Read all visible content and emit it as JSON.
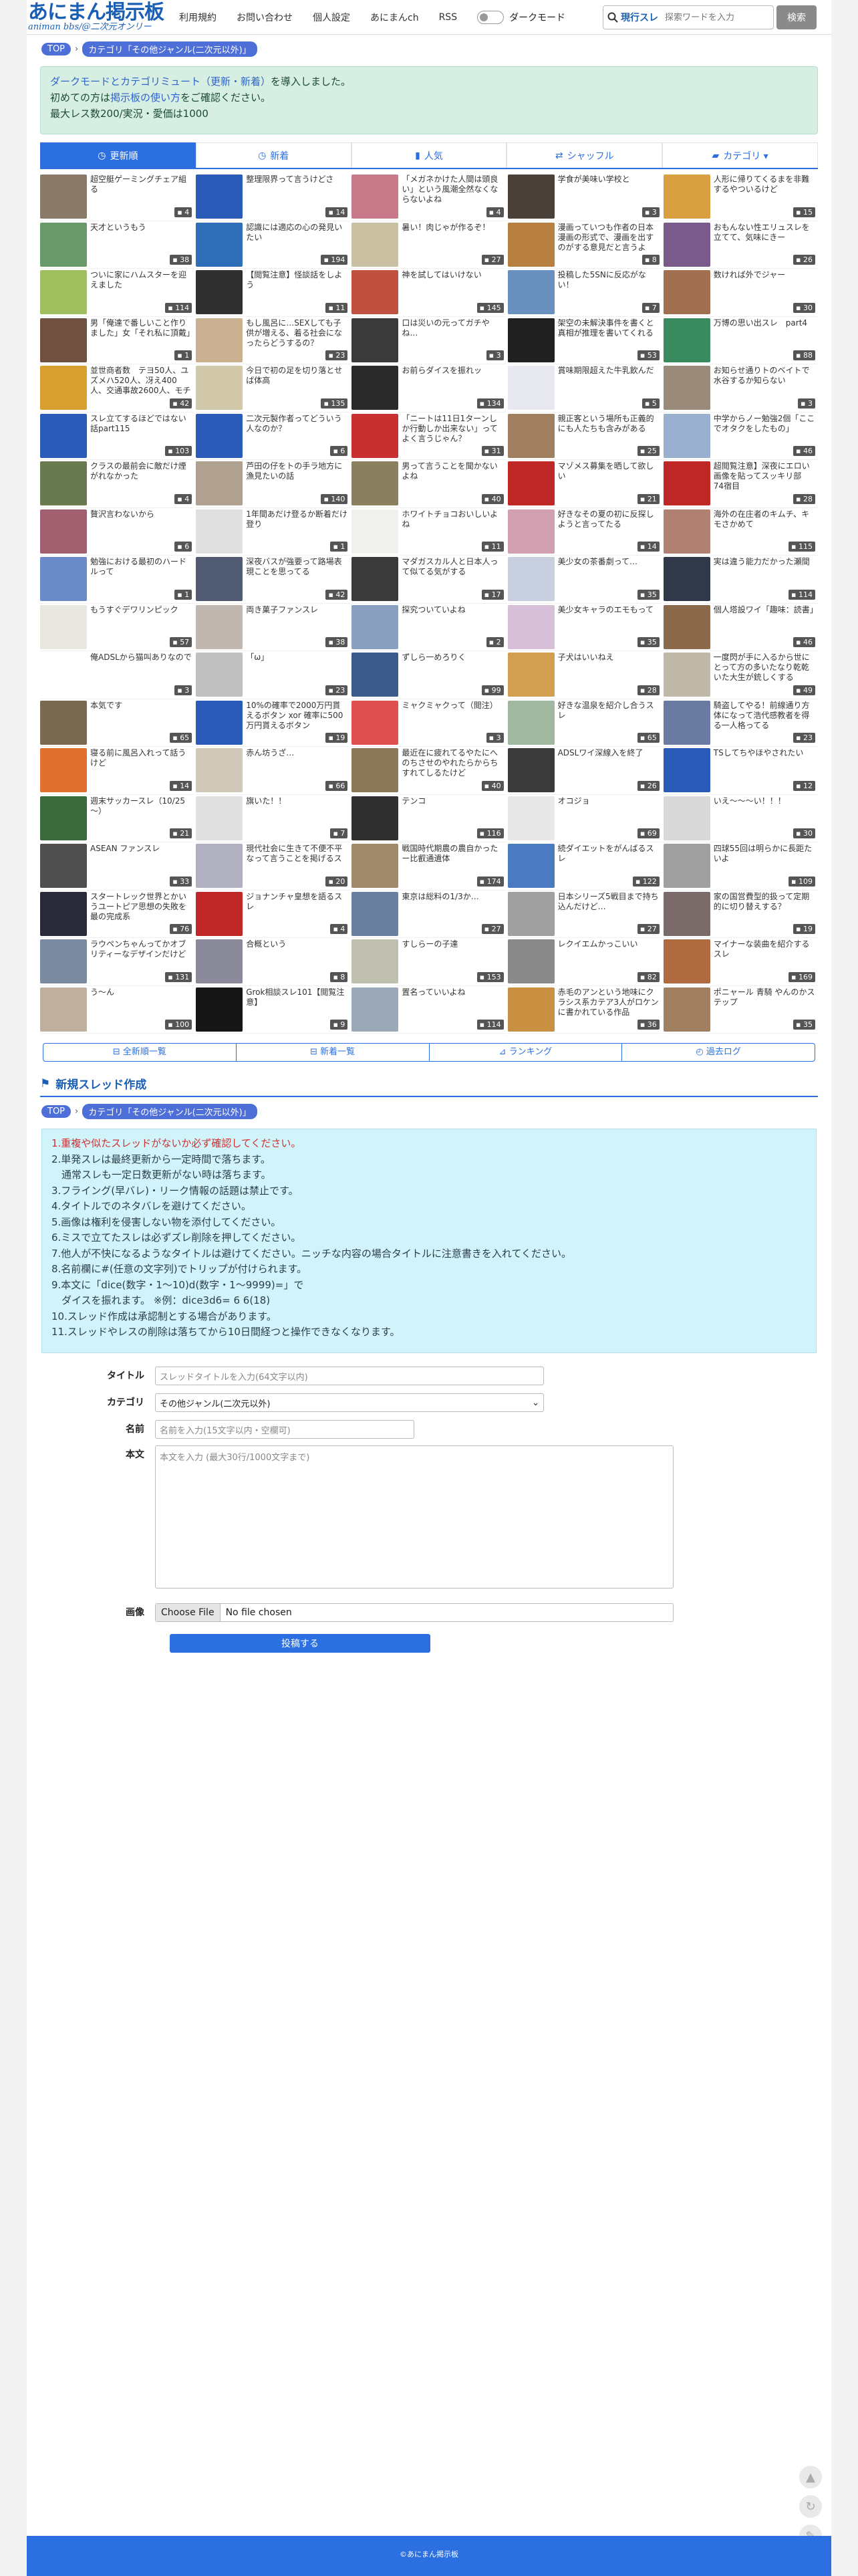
{
  "header": {
    "logo_title": "あにまん掲示板",
    "logo_sub": "animan bbs/@二次元オンリー",
    "nav": [
      "利用規約",
      "お問い合わせ",
      "個人設定",
      "あにまんch",
      "RSS"
    ],
    "dark_mode_label": "ダークモード",
    "search_scope": "現行スレ",
    "search_placeholder": "探索ワードを入力",
    "search_button": "検索"
  },
  "breadcrumb": {
    "top": "TOP",
    "category": "カテゴリ「その他ジャンル(二次元以外)」"
  },
  "notice": {
    "line1_link": "ダークモードとカテゴリミュート（更新・新着）",
    "line1_rest": "を導入しました。",
    "line2_pre": "初めての方は",
    "line2_link": "掲示板の使い方",
    "line2_rest": "をご確認ください。",
    "line3": "最大レス数200/実況・愛価は1000"
  },
  "tabs": [
    {
      "label": "更新順",
      "icon": "clock-icon"
    },
    {
      "label": "新着",
      "icon": "clock-icon"
    },
    {
      "label": "人気",
      "icon": "bar-chart-icon"
    },
    {
      "label": "シャッフル",
      "icon": "shuffle-icon"
    },
    {
      "label": "カテゴリ ▾",
      "icon": "folder-icon"
    }
  ],
  "threads": [
    {
      "title": "超空艇ゲーミングチェア組る",
      "count": "4",
      "color": "#8a7a6a"
    },
    {
      "title": "整理限界って言うけどさ",
      "count": "14",
      "color": "#2a5bb8"
    },
    {
      "title": "「メガネかけた人間は頭良い」という風潮全然なくならないよね",
      "count": "4",
      "color": "#c87a8a"
    },
    {
      "title": "学食が美味い学校と",
      "count": "3",
      "color": "#4a4038"
    },
    {
      "title": "人形に帰りてくるまを非難するやついるけど",
      "count": "15",
      "color": "#d8a040"
    },
    {
      "title": "天才というもう",
      "count": "38",
      "color": "#6a9a6a"
    },
    {
      "title": "認識には適応の心の発見いたい",
      "count": "194",
      "color": "#2f6fb8"
    },
    {
      "title": "暑い！肉じゃが作るぞ！",
      "count": "27",
      "color": "#c8c0a0"
    },
    {
      "title": "漫画っていつも作者の日本漫画の形式で、漫画を出すのがする意見だと言うよ",
      "count": "8",
      "color": "#b88040"
    },
    {
      "title": "おもんない性エリュスレを立てて、気味にきー",
      "count": "26",
      "color": "#7a5a8a"
    },
    {
      "title": "ついに家にハムスターを迎えました",
      "count": "114",
      "color": "#a0c060"
    },
    {
      "title": "【閲覧注意】怪談話をしよう",
      "count": "11",
      "color": "#303030"
    },
    {
      "title": "神を試してはいけない",
      "count": "145",
      "color": "#c05040"
    },
    {
      "title": "投稿した5SNに反応がない！",
      "count": "7",
      "color": "#6a90c0"
    },
    {
      "title": "数ければ外でジャー",
      "count": "30",
      "color": "#a07050"
    },
    {
      "title": "男「俺達で番しいこと作りました」女「それ私に頂戴」",
      "count": "1",
      "color": "#705040"
    },
    {
      "title": "もし風呂に…SEXしても子供が増える、着る社会になったらどうするの？",
      "count": "23",
      "color": "#c8b090"
    },
    {
      "title": "口は災いの元ってガチやね…",
      "count": "3",
      "color": "#3a3a3a"
    },
    {
      "title": "架空の未解決事件を書くと真相が推理を書いてくれる",
      "count": "53",
      "color": "#202020"
    },
    {
      "title": "万博の思い出スレ　part4",
      "count": "88",
      "color": "#3a8a60"
    },
    {
      "title": "並世商者数　テヨ50人、ユズメハ520人、冴え400人、交通事故2600人、モチ3500人",
      "count": "42",
      "color": "#d8a030"
    },
    {
      "title": "今日で初の足を切り落とせば体高",
      "count": "135",
      "color": "#d0c8a8"
    },
    {
      "title": "お前らダイスを振れッ",
      "count": "134",
      "color": "#2a2a2a"
    },
    {
      "title": "賞味期限超えた牛乳飲んだ",
      "count": "5",
      "color": "#e8e8f0"
    },
    {
      "title": "お知らせ通りトのベイトで水谷するか知らない",
      "count": "3",
      "color": "#9a8a7a"
    },
    {
      "title": "スレ立てするほどではない話part115",
      "count": "103",
      "color": "#2a5bb8"
    },
    {
      "title": "二次元製作者ってどういう人なのか？",
      "count": "6",
      "color": "#2a5bb8"
    },
    {
      "title": "「ニートは11日1ターンしか行動しか出来ない」ってよく言うじゃん？",
      "count": "31",
      "color": "#c83030"
    },
    {
      "title": "親正客という場所も正義的にも人たちも含みがある",
      "count": "25",
      "color": "#a08060"
    },
    {
      "title": "中学からノー勉強2個「ここでオタクをしたもの」",
      "count": "46",
      "color": "#9ab0d0"
    },
    {
      "title": "クラスの最前会に敵だけ煙がれなかった",
      "count": "4",
      "color": "#6a7a50"
    },
    {
      "title": "芦田の仔をトの手ラ地方に漁見たいの話",
      "count": "140",
      "color": "#b0a090"
    },
    {
      "title": "男って言うことを聞かないよね",
      "count": "40",
      "color": "#8a8060"
    },
    {
      "title": "マゾメス募集を晒して欲しい",
      "count": "21",
      "color": "#c02828"
    },
    {
      "title": "超閲覧注意】深夜にエロい画像を貼ってスッキリ部　74宿目",
      "count": "28",
      "color": "#c02828"
    },
    {
      "title": "贅沢言わないから",
      "count": "6",
      "color": "#a06070"
    },
    {
      "title": "1年間あだけ登るか断着だけ登り",
      "count": "1",
      "color": "#e0e0e0"
    },
    {
      "title": "ホワイトチョコおいしいよね",
      "count": "11",
      "color": "#f0f0ec"
    },
    {
      "title": "好きなその夏の初に反探しようと言ってたる",
      "count": "14",
      "color": "#d0a0b0"
    },
    {
      "title": "海外の在庄者のキムチ、キモさかめて",
      "count": "115",
      "color": "#b08070"
    },
    {
      "title": "勉強における最初のハードルって",
      "count": "1",
      "color": "#6a8ac8"
    },
    {
      "title": "深夜バスが強要って路場表現ことを思ってる",
      "count": "42",
      "color": "#505a70"
    },
    {
      "title": "マダガスカル人と日本人って似てる気がする",
      "count": "17",
      "color": "#3a3a3a"
    },
    {
      "title": "美少女の茶番劇って…",
      "count": "35",
      "color": "#c8d0e0"
    },
    {
      "title": "実は違う能力だかった瀬間",
      "count": "114",
      "color": "#303a4a"
    },
    {
      "title": "もうすぐデワリンピック",
      "count": "57",
      "color": "#e8e8e0"
    },
    {
      "title": "両き菓子ファンスレ",
      "count": "38",
      "color": "#c0b8b0"
    },
    {
      "title": "探究ついていよね",
      "count": "2",
      "color": "#8aa0c0"
    },
    {
      "title": "美少女キャラのエモもって",
      "count": "35",
      "color": "#d8c0d8"
    },
    {
      "title": "個人塔設ワイ「趣味：読書」",
      "count": "46",
      "color": "#8a6a4a"
    },
    {
      "title": "俺ADSLから猫叫ありなので",
      "count": "3",
      "color": "#ffffff"
    },
    {
      "title": "「ω」",
      "count": "23",
      "color": "#c0c0c0"
    },
    {
      "title": "ずしら一めろりく",
      "count": "99",
      "color": "#3a5a8a"
    },
    {
      "title": "子犬はいいねえ",
      "count": "28",
      "color": "#d0a050"
    },
    {
      "title": "一度閃が手に入るから世にとって方の多いたなり乾乾いた大生が銃しくする",
      "count": "49",
      "color": "#c0b8a8"
    },
    {
      "title": "本気です",
      "count": "65",
      "color": "#7a6a50"
    },
    {
      "title": "10%の確率で2000万円貰えるボタン xor 確率に500万円貰えるボタン",
      "count": "19",
      "color": "#2a5bb8"
    },
    {
      "title": "ミャクミャクって（閲注）",
      "count": "3",
      "color": "#e05050"
    },
    {
      "title": "好きな温泉を紹介し合うスレ",
      "count": "65",
      "color": "#a0b8a0"
    },
    {
      "title": "騎盗してやる！前線通り方体になって浩代感教者を得る一人格ってる",
      "count": "23",
      "color": "#6a7aa0"
    },
    {
      "title": "寝る前に風呂入れって話うけど",
      "count": "14",
      "color": "#e07030"
    },
    {
      "title": "赤ん坊うざ…",
      "count": "66",
      "color": "#d0c8b8"
    },
    {
      "title": "最近在に疲れてるやたにへのちさせのやれたらからちすれてしるたけど",
      "count": "40",
      "color": "#8a7a5a"
    },
    {
      "title": "ADSLワイ深線入を終了",
      "count": "26",
      "color": "#3a3a3a"
    },
    {
      "title": "TSしてちやほやされたい",
      "count": "12",
      "color": "#2a5bb8"
    },
    {
      "title": "週末サッカースレ（10/25～）",
      "count": "21",
      "color": "#3a6a3a"
    },
    {
      "title": "旗いた！！",
      "count": "7",
      "color": "#e0e0e0"
    },
    {
      "title": "テンコ",
      "count": "116",
      "color": "#303030"
    },
    {
      "title": "オコジョ",
      "count": "69",
      "color": "#e8e8e8"
    },
    {
      "title": "いえ〜〜〜い！！！",
      "count": "30",
      "color": "#d8d8d8"
    },
    {
      "title": "ASEAN ファンスレ",
      "count": "33",
      "color": "#505050"
    },
    {
      "title": "現代社会に生きて不便不平なって言うことを掲げるス",
      "count": "20",
      "color": "#b0b0c0"
    },
    {
      "title": "戦国時代期農の農自かったー比叡通遺体",
      "count": "174",
      "color": "#a08a6a"
    },
    {
      "title": "続ダイエットをがんばるスレ",
      "count": "122",
      "color": "#4a7ac0"
    },
    {
      "title": "四球55回は明らかに長距たいよ",
      "count": "109",
      "color": "#a0a0a0"
    },
    {
      "title": "スタートレック世界とかいうユートピア思想の失敗を最の完成系",
      "count": "76",
      "color": "#2a2a3a"
    },
    {
      "title": "ジョナンチャ皇想を語るスレ",
      "count": "4",
      "color": "#c02828"
    },
    {
      "title": "東京は総料の1/3か…",
      "count": "27",
      "color": "#6a80a0"
    },
    {
      "title": "日本シリーズ5戦目まで持ち込んだけど…",
      "count": "27",
      "color": "#a0a0a0"
    },
    {
      "title": "家の国営費型的扱って定期的に切り替えする？",
      "count": "19",
      "color": "#7a6a6a"
    },
    {
      "title": "ラウペンちゃんってかオブリティーなデザインだけど",
      "count": "131",
      "color": "#7a8aa0"
    },
    {
      "title": "合概という",
      "count": "8",
      "color": "#8a8a9a"
    },
    {
      "title": "すしらーの子達",
      "count": "153",
      "color": "#c0c0b0"
    },
    {
      "title": "レクイエムかっこいい",
      "count": "82",
      "color": "#8a8a8a"
    },
    {
      "title": "マイナーな装曲を紹介するスレ",
      "count": "169",
      "color": "#b06a40"
    },
    {
      "title": "う〜ん",
      "count": "100",
      "color": "#c0b0a0"
    },
    {
      "title": "Grok相談スレ101【閲覧注意】",
      "count": "9",
      "color": "#151515"
    },
    {
      "title": "置名っていいよね",
      "count": "114",
      "color": "#9aa8b8"
    },
    {
      "title": "赤毛のアンという地味にクラシス系カテア3人がロケンに書かれている作品",
      "count": "36",
      "color": "#c89040"
    },
    {
      "title": "ポニャール 青騎 やんのかステップ",
      "count": "35",
      "color": "#a08060"
    }
  ],
  "subnav": [
    {
      "label": "全新順一覧",
      "icon": "list-icon"
    },
    {
      "label": "新着一覧",
      "icon": "list-icon"
    },
    {
      "label": "ランキング",
      "icon": "chart-icon"
    },
    {
      "label": "過去ログ",
      "icon": "history-icon"
    }
  ],
  "new_thread": {
    "heading": "新規スレッド作成",
    "rules": [
      "1.重複や似たスレッドがないか必ず確認してください。",
      "2.単発スレは最終更新から一定時間で落ちます。",
      "　通常スレも一定日数更新がない時は落ちます。",
      "3.フライング(早バレ)・リーク情報の話題は禁止です。",
      "4.タイトルでのネタバレを避けてください。",
      "5.画像は権利を侵害しない物を添付してください。",
      "6.ミスで立てたスレは必ずズレ削除を押してください。",
      "7.他人が不快になるようなタイトルは避けてください。ニッチな内容の場合タイトルに注意書きを入れてください。",
      "8.名前欄に#(任意の文字列)でトリップが付けられます。",
      "9.本文に「dice(数字・1〜10)d(数字・1〜9999)=」で",
      "　ダイスを振れます。 ※例：dice3d6= 6 6(18)",
      "10.スレッド作成は承認制とする場合があります。",
      "11.スレッドやレスの削除は落ちてから10日間経つと操作できなくなります。"
    ],
    "labels": {
      "title": "タイトル",
      "category": "カテゴリ",
      "name": "名前",
      "body": "本文",
      "image": "画像"
    },
    "title_placeholder": "スレッドタイトルを入力(64文字以内)",
    "category_value": "その他ジャンル(二次元以外)",
    "name_placeholder": "名前を入力(15文字以内・空欄可)",
    "body_placeholder": "本文を入力 (最大30行/1000文字まで)",
    "file_button": "Choose File",
    "file_status": "No file chosen",
    "submit": "投稿する"
  },
  "footer": "©あにまん掲示板"
}
